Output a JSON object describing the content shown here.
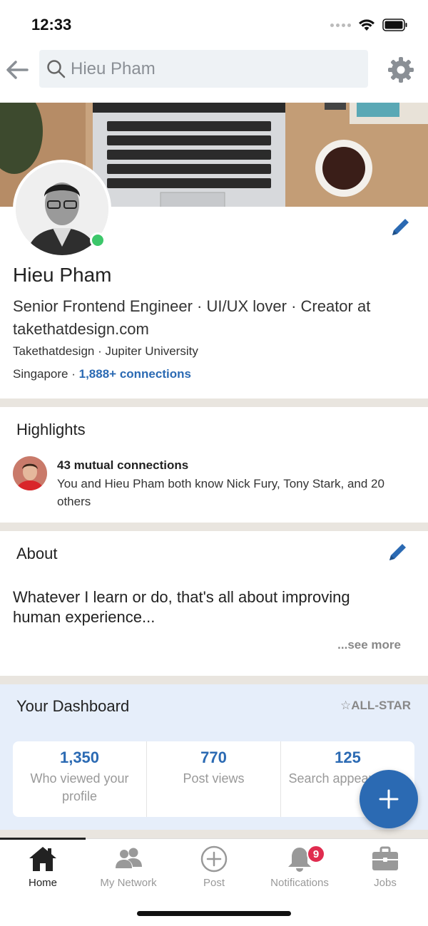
{
  "status_bar": {
    "time": "12:33"
  },
  "search": {
    "placeholder": "Hieu Pham"
  },
  "profile": {
    "name": "Hieu Pham",
    "headline": "Senior Frontend Engineer · UI/UX lover · Creator at takethatdesign.com",
    "company_school": "Takethatdesign · Jupiter University",
    "location": "Singapore",
    "location_separator": " · ",
    "connections": "1,888+ connections",
    "online": true
  },
  "highlights": {
    "title": "Highlights",
    "mutual_title": "43 mutual connections",
    "mutual_desc": "You and Hieu Pham both know Nick Fury, Tony Stark, and 20 others"
  },
  "about": {
    "title": "About",
    "text": "Whatever I learn or do, that's all about improving human experience...",
    "see_more": "...see more"
  },
  "dashboard": {
    "title": "Your Dashboard",
    "badge": "☆ALL-STAR",
    "stats": [
      {
        "value": "1,350",
        "label": "Who viewed your profile"
      },
      {
        "value": "770",
        "label": "Post views"
      },
      {
        "value": "125",
        "label": "Search appearances"
      }
    ]
  },
  "bottom_nav": {
    "items": [
      {
        "label": "Home",
        "icon": "home-icon"
      },
      {
        "label": "My Network",
        "icon": "people-icon"
      },
      {
        "label": "Post",
        "icon": "plus-circle-icon"
      },
      {
        "label": "Notifications",
        "icon": "bell-icon"
      },
      {
        "label": "Jobs",
        "icon": "briefcase-icon"
      }
    ],
    "notification_count": "9"
  },
  "colors": {
    "accent": "#2b6ab3",
    "online": "#3cc76a",
    "badge": "#e02c4f",
    "divider": "#e9e5df",
    "dashboard_bg": "#e6eefa"
  }
}
